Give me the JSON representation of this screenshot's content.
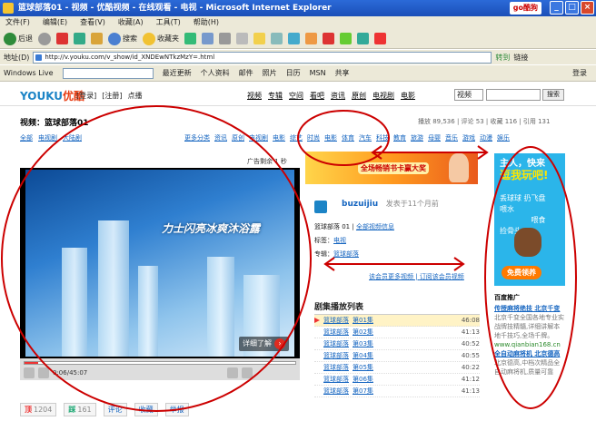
{
  "window": {
    "title": "篮球部落01 - 视频 - 优酷视频 - 在线观看 - 电视 - Microsoft Internet Explorer",
    "ext": "go酷狗",
    "min": "_",
    "max": "□",
    "close": "×"
  },
  "menu": [
    "文件(F)",
    "编辑(E)",
    "查看(V)",
    "收藏(A)",
    "工具(T)",
    "帮助(H)"
  ],
  "toolbar": {
    "back": "后退",
    "search": "搜索",
    "favorites": "收藏夹"
  },
  "address": {
    "label": "地址(D)",
    "url": "http://v.youku.com/v_show/id_XNDEwNTkzMzY=.html",
    "go": "转到",
    "links": "链接"
  },
  "linksbar": {
    "brand": "Windows Live",
    "items": [
      "最近更新",
      "个人资料",
      "邮件",
      "照片",
      "日历",
      "MSN",
      "共享"
    ],
    "login": "登录"
  },
  "youku": {
    "logo_a": "YOUKU",
    "logo_b": "优酷",
    "top": [
      "[登录]",
      "[注册]",
      "点播"
    ],
    "nav": [
      "视频",
      "专辑",
      "空间",
      "看吧",
      "资讯",
      "原创",
      "电视剧",
      "电影"
    ],
    "select": "视频",
    "search_btn": "搜索"
  },
  "video": {
    "title": "视频：篮球部落01",
    "stats": "播放 89,536 | 评论 53 | 收藏 116 | 引用 131",
    "breadcrumb": [
      "全部",
      "电视剧",
      "大陆剧"
    ],
    "categories": [
      "更多分类",
      "资讯",
      "原创",
      "电视剧",
      "电影",
      "综艺",
      "时尚",
      "电影",
      "体育",
      "汽车",
      "科技",
      "教育",
      "旅游",
      "母婴",
      "音乐",
      "游戏",
      "动漫",
      "娱乐"
    ],
    "ad_label": "广告剩余 1 秒",
    "slogan": "力士闪亮冰爽沐浴露",
    "detail": "详细了解",
    "time": "0:06/45:07",
    "progress": 0.05
  },
  "actions": [
    {
      "icon": "顶",
      "label": "顶",
      "count": "1204"
    },
    {
      "icon": "踩",
      "label": "踩",
      "count": "161"
    },
    {
      "icon": "评",
      "label": "评论"
    },
    {
      "icon": "收",
      "label": "收藏"
    },
    {
      "icon": "举",
      "label": "举报"
    }
  ],
  "banner": {
    "text": "全场畅销书卡赢大奖"
  },
  "uploader": {
    "name": "buzuijiu",
    "posted": "发表于11个月前",
    "series": "篮球部落 01",
    "series_link": "全部视频信息",
    "tag_label": "标签：",
    "tag": "电视",
    "album_label": "专辑：",
    "album": "篮球部落",
    "more1": "该会员更多视频",
    "more2": "订阅该会员视频"
  },
  "playlist": {
    "title": "剧集播放列表",
    "items": [
      {
        "name": "篮球部落",
        "ep": "第01集",
        "dur": "46:08",
        "current": true
      },
      {
        "name": "篮球部落",
        "ep": "第02集",
        "dur": "41:13"
      },
      {
        "name": "篮球部落",
        "ep": "第03集",
        "dur": "40:52"
      },
      {
        "name": "篮球部落",
        "ep": "第04集",
        "dur": "40:55"
      },
      {
        "name": "篮球部落",
        "ep": "第05集",
        "dur": "40:22"
      },
      {
        "name": "篮球部落",
        "ep": "第06集",
        "dur": "41:12"
      },
      {
        "name": "篮球部落",
        "ep": "第07集",
        "dur": "41:13"
      }
    ]
  },
  "sidead": {
    "l1": "主人，快来",
    "l2": "逗我玩吧!",
    "l3": "丢球球   扔飞盘",
    "l4": "喂水",
    "l5": "喂食",
    "l6": "捡骨头",
    "cta": "免费领养"
  },
  "sidetext": {
    "hd": "百度推广",
    "lk1": "传授麻将绝技 北京千变",
    "g1": "北京千变全国各地专业实战牌技精髓,详细讲解本地千技巧,全场千牌。",
    "u1": "www.qianbian168.cn",
    "lk2": "全自动麻将机 北京德高",
    "g2": "北京德高,中档次精品全自动麻将机,质量可靠"
  }
}
